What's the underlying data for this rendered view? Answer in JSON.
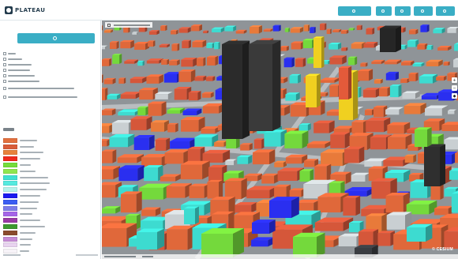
{
  "app": {
    "logo_text": "PLATEAU"
  },
  "header": {
    "buttons": [
      {
        "name": "share-button",
        "label": "",
        "icon": "share-icon"
      },
      {
        "name": "settings-button",
        "label": "",
        "icon": "gear-icon"
      },
      {
        "name": "help-button",
        "label": "",
        "icon": "help-icon"
      },
      {
        "name": "info-button",
        "label": "",
        "icon": "info-icon"
      },
      {
        "name": "menu-button",
        "label": "",
        "icon": "menu-icon"
      }
    ]
  },
  "sidebar": {
    "primary_button_label": "",
    "options": [
      {
        "label": "",
        "checked": false
      },
      {
        "label": "",
        "checked": false
      },
      {
        "label": "",
        "checked": false
      },
      {
        "label": "",
        "checked": false
      },
      {
        "label": "",
        "checked": false
      },
      {
        "label": "",
        "checked": false
      },
      {
        "label": "",
        "checked": false
      },
      {
        "label": "",
        "checked": false
      }
    ],
    "legend_title": "",
    "legend": [
      {
        "label": "",
        "color": "#e2703e"
      },
      {
        "label": "",
        "color": "#d95d3a"
      },
      {
        "label": "",
        "color": "#e8823c"
      },
      {
        "label": "",
        "color": "#ef2b1e"
      },
      {
        "label": "",
        "color": "#74dd3b"
      },
      {
        "label": "",
        "color": "#8fe64f"
      },
      {
        "label": "",
        "color": "#3fe0d3"
      },
      {
        "label": "",
        "color": "#55eadf"
      },
      {
        "label": "",
        "color": "#b7f2ec"
      },
      {
        "label": "",
        "color": "#1b1bf0"
      },
      {
        "label": "",
        "color": "#3b5ef3"
      },
      {
        "label": "",
        "color": "#7d7de9"
      },
      {
        "label": "",
        "color": "#a566e8"
      },
      {
        "label": "",
        "color": "#9a3aa6"
      },
      {
        "label": "",
        "color": "#3d9a2f"
      },
      {
        "label": "",
        "color": "#8a4b2d"
      },
      {
        "label": "",
        "color": "#c58bd4"
      },
      {
        "label": "",
        "color": "#e8d3ef"
      },
      {
        "label": "",
        "color": "#f7f3f8"
      }
    ],
    "footer_left": "",
    "footer_right": ""
  },
  "map": {
    "badge_text": "",
    "attribution": "",
    "brand": "© CESIUM",
    "layer_colors": {
      "commercial": "#e0683a",
      "office": "#d5573a",
      "residential": "#3ddbd0",
      "public": "#74d93c",
      "industrial": "#2a2ff0",
      "tower": "#2b2b2b",
      "special": "#f0d020",
      "ground": "#8f9498"
    }
  }
}
